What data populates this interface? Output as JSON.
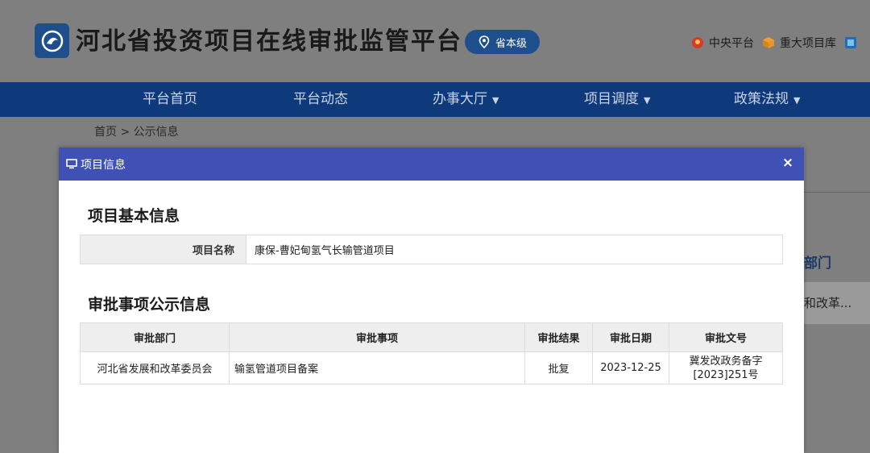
{
  "header": {
    "site_title": "河北省投资项目在线审批监管平台",
    "level_badge": "省本级",
    "top_links": [
      {
        "label": "中央平台",
        "icon": "emblem-icon"
      },
      {
        "label": "重大项目库",
        "icon": "box-icon"
      }
    ]
  },
  "nav": {
    "items": [
      {
        "label": "平台首页",
        "has_dropdown": false
      },
      {
        "label": "平台动态",
        "has_dropdown": false
      },
      {
        "label": "办事大厅",
        "has_dropdown": true
      },
      {
        "label": "项目调度",
        "has_dropdown": true
      },
      {
        "label": "政策法规",
        "has_dropdown": true
      }
    ]
  },
  "breadcrumb": {
    "home": "首页",
    "separator": ">",
    "current": "公示信息"
  },
  "background_panel": {
    "column_head": "部门",
    "row_value": "和改革..."
  },
  "modal": {
    "title": "项目信息",
    "close_label": "×",
    "basic_section_title": "项目基本信息",
    "project_name_label": "项目名称",
    "project_name_value": "康保-曹妃甸氢气长输管道项目",
    "approval_section_title": "审批事项公示信息",
    "approval_table": {
      "headers": [
        "审批部门",
        "审批事项",
        "审批结果",
        "审批日期",
        "审批文号"
      ],
      "rows": [
        {
          "department": "河北省发展和改革委员会",
          "item": "输氢管道项目备案",
          "result": "批复",
          "date": "2023-12-25",
          "doc_no_line1": "冀发改政务备字",
          "doc_no_line2": "[2023]251号"
        }
      ]
    }
  },
  "colors": {
    "header_blue": "#1f4e8c",
    "nav_blue": "#0e3a7c",
    "modal_header": "#3f51b5",
    "overlay": "#7f7f7f"
  }
}
